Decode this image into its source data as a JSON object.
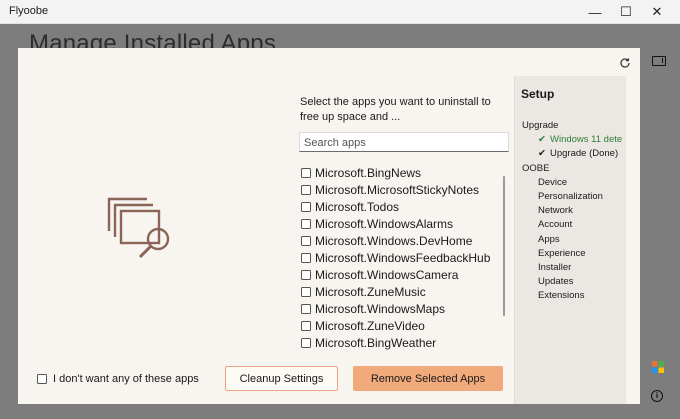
{
  "window": {
    "title": "Flyoobe",
    "minimize_glyph": "—",
    "maximize_glyph": "☐",
    "close_glyph": "✕"
  },
  "background_heading": "Manage Installed Apps",
  "dialog": {
    "prompt": "Select the apps you want to uninstall to free up space and ...",
    "search_placeholder": "Search apps",
    "apps": [
      {
        "name": "Microsoft.BingNews",
        "checked": false
      },
      {
        "name": "Microsoft.MicrosoftStickyNotes",
        "checked": false
      },
      {
        "name": "Microsoft.Todos",
        "checked": false
      },
      {
        "name": "Microsoft.WindowsAlarms",
        "checked": false
      },
      {
        "name": "Microsoft.Windows.DevHome",
        "checked": false
      },
      {
        "name": "Microsoft.WindowsFeedbackHub",
        "checked": false
      },
      {
        "name": "Microsoft.WindowsCamera",
        "checked": false
      },
      {
        "name": "Microsoft.ZuneMusic",
        "checked": false
      },
      {
        "name": "Microsoft.WindowsMaps",
        "checked": false
      },
      {
        "name": "Microsoft.ZuneVideo",
        "checked": false
      },
      {
        "name": "Microsoft.BingWeather",
        "checked": false
      }
    ],
    "opt_out_label": "I don't want any of these apps",
    "cleanup_button": "Cleanup Settings",
    "remove_button": "Remove Selected Apps"
  },
  "setup": {
    "title": "Setup",
    "upgrade_label": "Upgrade",
    "upgrade_items": [
      {
        "label": "Windows 11 dete",
        "checked": true,
        "highlight": true
      },
      {
        "label": "Upgrade (Done)",
        "checked": true,
        "highlight": false
      }
    ],
    "oobe_label": "OOBE",
    "oobe_items": [
      "Device",
      "Personalization",
      "Network",
      "Account",
      "Apps",
      "Experience",
      "Installer",
      "Updates",
      "Extensions"
    ]
  },
  "colors": {
    "accent": "#f1aa7b",
    "accent_border": "#eba57e",
    "success_green": "#2f7d32",
    "illustration": "#8a6457"
  }
}
